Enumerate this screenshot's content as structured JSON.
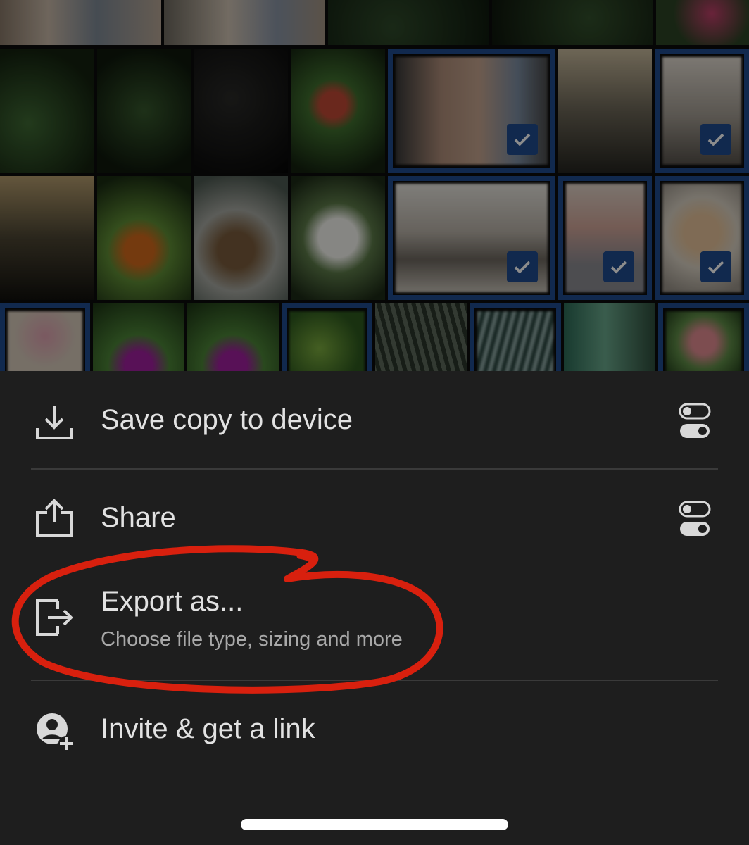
{
  "actions": [
    {
      "id": "save",
      "label": "Save copy to device",
      "icon": "download-icon",
      "has_toggle": true
    },
    {
      "id": "share",
      "label": "Share",
      "icon": "share-icon",
      "has_toggle": true
    },
    {
      "id": "export",
      "label": "Export as...",
      "sublabel": "Choose file type, sizing and more",
      "icon": "export-icon",
      "has_toggle": false
    },
    {
      "id": "invite",
      "label": "Invite & get a link",
      "icon": "invite-user-icon",
      "has_toggle": false
    }
  ],
  "colors": {
    "sheet_background": "#1e1e1e",
    "selection": "#1f4b8f",
    "annotation": "#d8200e",
    "text": "#e2e2e2",
    "subtext": "#a8a8a8"
  }
}
